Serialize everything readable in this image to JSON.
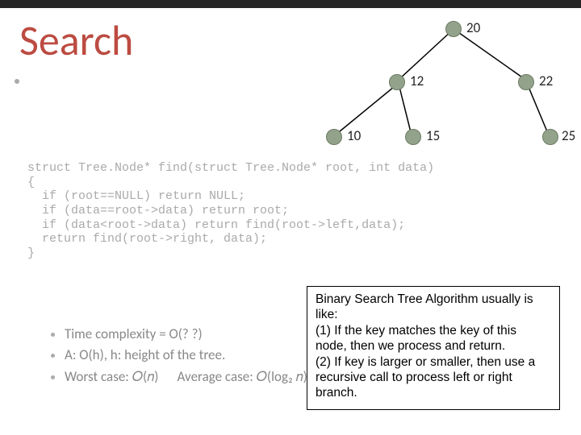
{
  "title": "Search",
  "tree": {
    "n1": "20",
    "n2": "12",
    "n3": "22",
    "n4": "10",
    "n5": "15",
    "n6": "25"
  },
  "code": {
    "l1": "struct Tree.Node* find(struct Tree.Node* root, int data)",
    "l2": "{",
    "l3": "  if (root==NULL) return NULL;",
    "l4": "  if (data==root->data) return root;",
    "l5": "  if (data<root->data) return find(root->left,data);",
    "l6": "  return find(root->right, data);",
    "l7": "}"
  },
  "bullets": {
    "b1": "Time complexity = O(? ?)",
    "b2": "A: O(h), h: height of the tree.",
    "b3_a": "Worst case: 𝑂(𝑛)",
    "b3_b": "Average case: 𝑂(log₂ 𝑛)"
  },
  "callout": {
    "l1": "Binary Search Tree Algorithm usually is like:",
    "l2": "(1) If the key matches the key of this node, then we process and return.",
    "l3": "(2) If key is larger or smaller, then use a recursive call to process left or right branch."
  }
}
